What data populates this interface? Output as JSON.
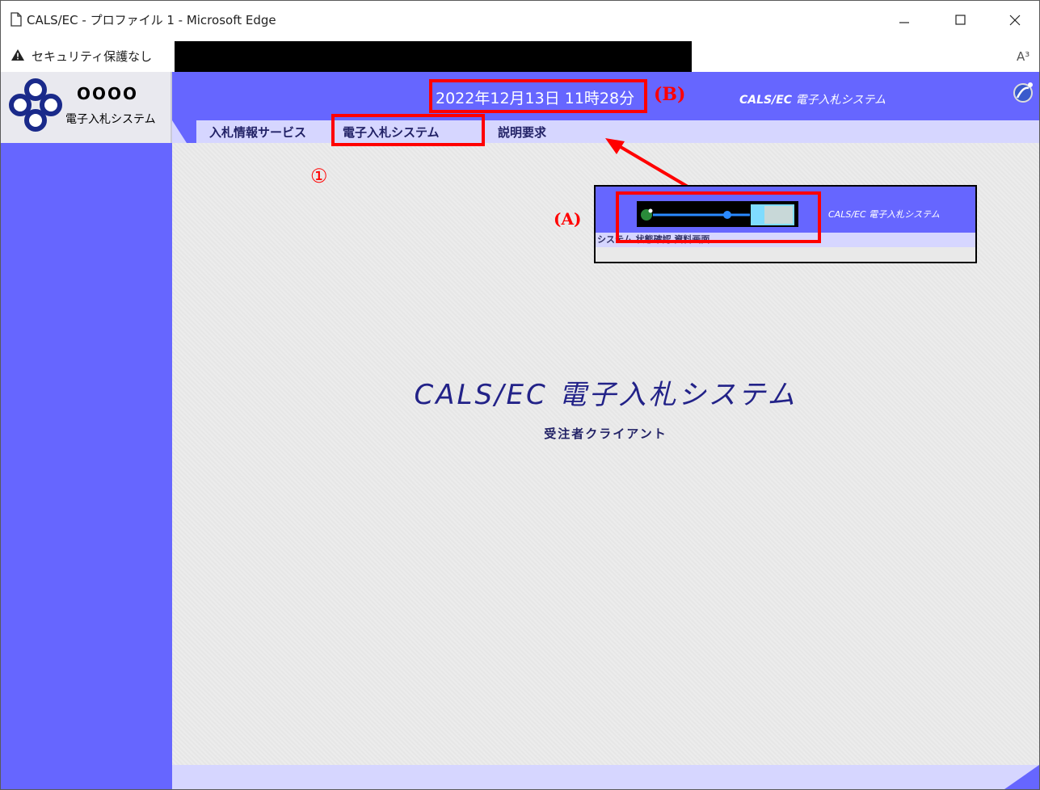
{
  "window": {
    "title": "CALS/EC - プロファイル 1 - Microsoft Edge",
    "minimize_icon": "minimize-icon",
    "maximize_icon": "maximize-icon",
    "close_icon": "close-icon"
  },
  "address_bar": {
    "security_label": "セキュリティ保護なし",
    "read_aloud": "A³"
  },
  "logo": {
    "title": "OOOO",
    "subtitle": "電子入札システム"
  },
  "header": {
    "datetime": "2022年12月13日 11時28分",
    "brand_prefix": "CALS/EC",
    "brand_suffix": " 電子入札システム"
  },
  "tabs": [
    {
      "label": "入札情報サービス"
    },
    {
      "label": "電子入札システム"
    },
    {
      "label": "説明要求"
    }
  ],
  "main": {
    "title": "CALS/EC 電子入札システム",
    "subtitle": "受注者クライアント"
  },
  "annotations": {
    "label_b": "(B)",
    "label_a": "(A)",
    "label_1": "①",
    "color": "#ff0000"
  },
  "inset": {
    "brand": "CALS/EC 電子入札システム",
    "tab_text": "システム  状態確認  資料画面"
  },
  "colors": {
    "accent": "#6666ff",
    "tab_band": "#d6d6ff",
    "text_dark": "#222288"
  }
}
